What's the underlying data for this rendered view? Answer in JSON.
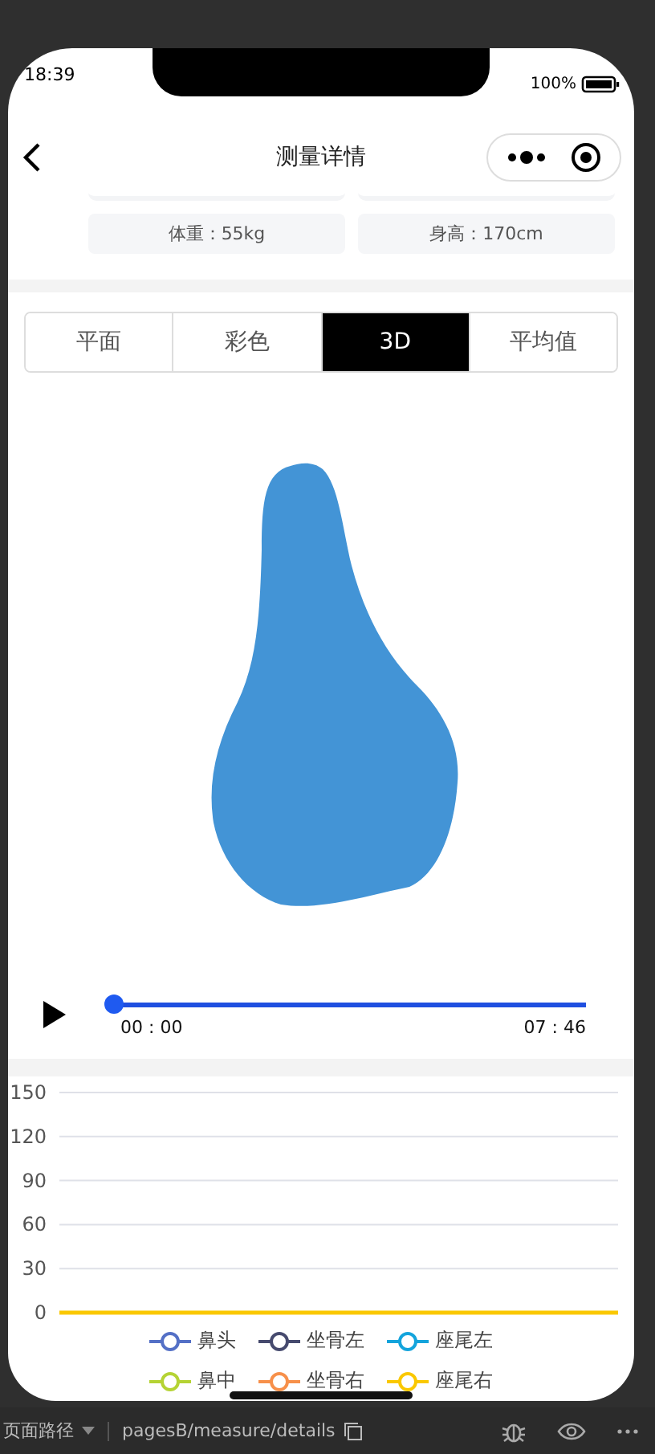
{
  "status_bar": {
    "time": "18:39",
    "battery": "100%"
  },
  "nav": {
    "title": "测量详情"
  },
  "info": [
    "体重：55kg",
    "身高：170cm"
  ],
  "tabs": [
    {
      "label": "平面",
      "selected": false
    },
    {
      "label": "彩色",
      "selected": false
    },
    {
      "label": "3D",
      "selected": true
    },
    {
      "label": "平均值",
      "selected": false
    }
  ],
  "player": {
    "playing": false,
    "level": 0,
    "start": "00 : 00",
    "end": "07 : 46"
  },
  "chart": {
    "chart_data": {
      "type": "line",
      "grid": true,
      "legend": true,
      "ylim": [
        0,
        150
      ],
      "yticks": [
        0,
        30,
        60,
        90,
        120,
        150
      ],
      "series": [
        {
          "name": "鼻头",
          "color": "#5470c6",
          "values": [
            null,
            null,
            null,
            null,
            null,
            null,
            null,
            null,
            null,
            null
          ]
        },
        {
          "name": "坐骨左",
          "color": "#464a6e",
          "values": [
            null,
            null,
            null,
            null,
            null,
            null,
            null,
            null,
            null,
            null
          ]
        },
        {
          "name": "座尾左",
          "color": "#14a4dc",
          "values": [
            null,
            null,
            null,
            null,
            null,
            null,
            null,
            null,
            null,
            null
          ]
        },
        {
          "name": "鼻中",
          "color": "#b5d334",
          "values": [
            null,
            null,
            null,
            null,
            null,
            null,
            null,
            null,
            null,
            null
          ]
        },
        {
          "name": "坐骨右",
          "color": "#f7904a",
          "values": [
            null,
            null,
            null,
            null,
            null,
            null,
            null,
            null,
            null,
            null
          ]
        },
        {
          "name": "座尾右",
          "color": "#fac800",
          "values": [
            0,
            0,
            0,
            0,
            0,
            0,
            0,
            0,
            0,
            0
          ]
        }
      ]
    }
  },
  "devtools": {
    "path_label": "页面路径",
    "path": "pagesB/measure/details"
  }
}
